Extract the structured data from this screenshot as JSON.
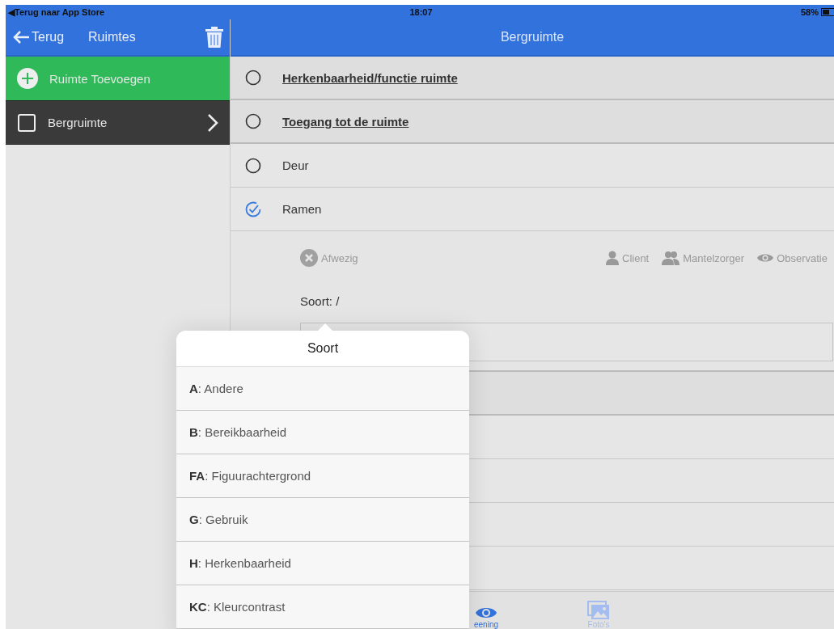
{
  "status_bar": {
    "back_label": "◀Terug naar App Store",
    "time": "18:07",
    "battery": "58%"
  },
  "sidebar": {
    "back": "Terug",
    "title": "Ruimtes",
    "items": [
      {
        "kind": "add",
        "label": "Ruimte Toevoegen"
      },
      {
        "kind": "room",
        "label": "Bergruimte",
        "checked": false
      }
    ]
  },
  "main": {
    "title": "Bergruimte",
    "rows": [
      {
        "kind": "heading",
        "label": "Herkenbaarheid/functie ruimte",
        "checked": false
      },
      {
        "kind": "heading",
        "label": "Toegang tot de ruimte",
        "checked": false
      },
      {
        "kind": "item",
        "label": "Deur",
        "checked": false
      },
      {
        "kind": "item",
        "label": "Ramen",
        "checked": true,
        "expanded": true
      }
    ],
    "detail": {
      "absent": "Afwezig",
      "sources": [
        "Client",
        "Mantelzorger",
        "Observatie"
      ],
      "type_label": "Soort: /"
    },
    "hidden_rows": [
      {
        "kind": "heading"
      },
      {
        "kind": "item"
      },
      {
        "kind": "item"
      },
      {
        "kind": "item"
      },
      {
        "kind": "item"
      }
    ]
  },
  "tab_bar": [
    {
      "label": "eening",
      "selected": true
    },
    {
      "label": "Foto's",
      "selected": false
    }
  ],
  "popover": {
    "title": "Soort",
    "options": [
      "**A**: Andere",
      "**B**: Bereikbaarheid",
      "**FA**: Figuurachtergrond",
      "**G**: Gebruik",
      "**H**: Herkenbaarheid",
      "**KC**: Kleurcontrast"
    ]
  }
}
